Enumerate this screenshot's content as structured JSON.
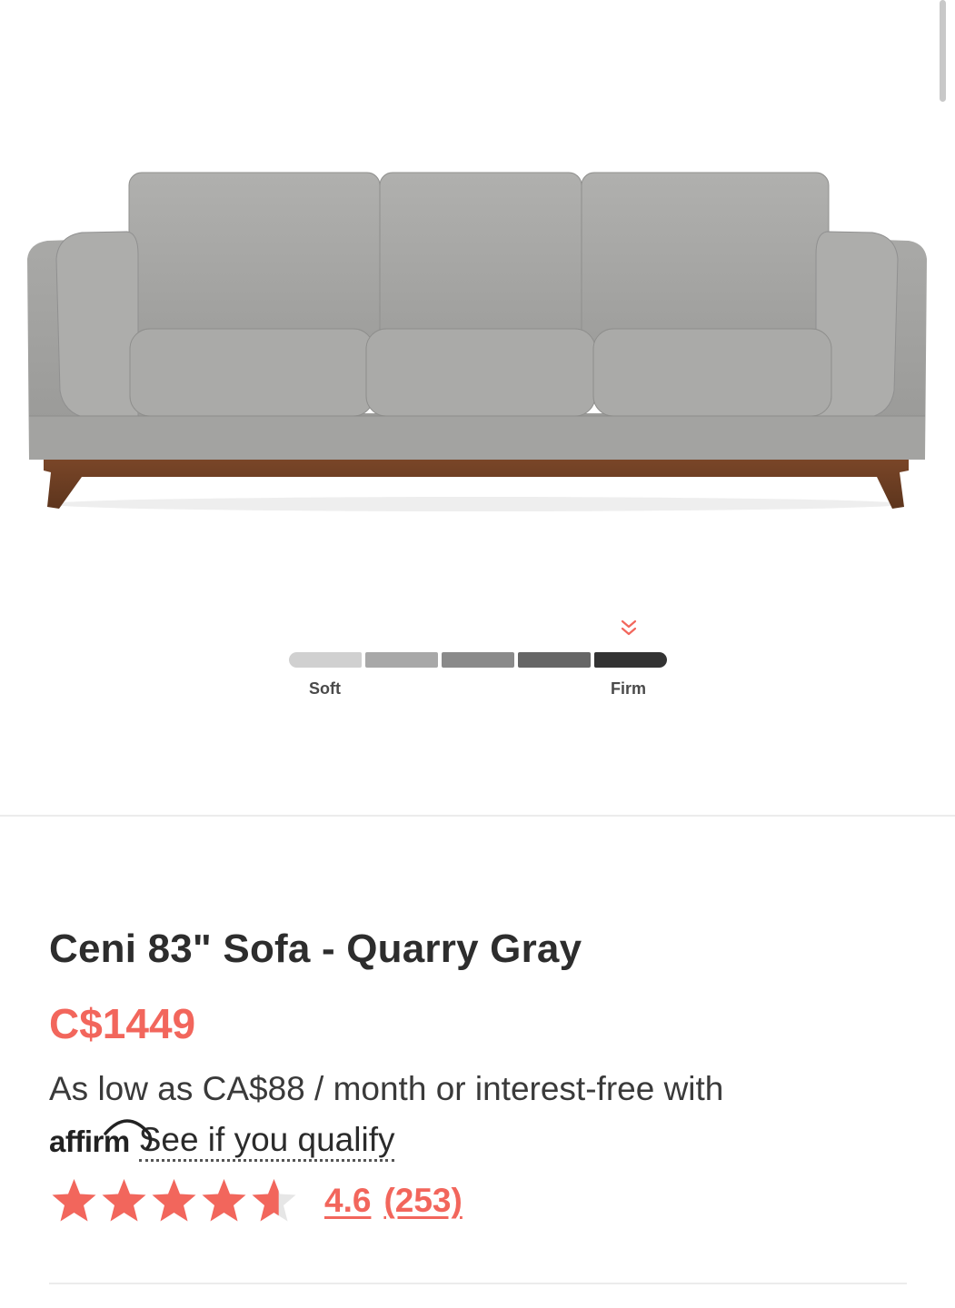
{
  "product": {
    "title": "Ceni 83\" Sofa - Quarry Gray",
    "price": "C$1449",
    "financing_text": "As low as CA$88 / month or interest-free with",
    "affirm_logo": "affirm",
    "qualify_link": "See if you qualify",
    "rating": {
      "value": "4.6",
      "count": "(253)",
      "stars": 4.6,
      "max_stars": 5,
      "star_color": "#f2665c"
    }
  },
  "firmness": {
    "low_label": "Soft",
    "high_label": "Firm",
    "level": 5,
    "levels": 5,
    "indicator_icon": "double-chevron-down-icon",
    "indicator_color": "#f2665c"
  },
  "hero_image": {
    "icon": "sofa-image",
    "fabric_color": "#a6a6a4",
    "base_color": "#6b3d22"
  },
  "colors": {
    "accent": "#f2665c",
    "text": "#2d2d2d"
  }
}
